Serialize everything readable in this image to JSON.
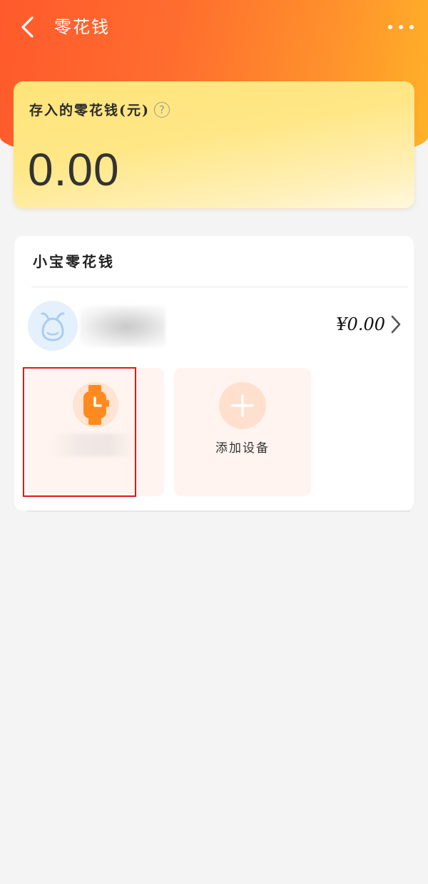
{
  "header": {
    "title": "零花钱",
    "back_icon": "back-arrow-icon",
    "more_icon": "more-dots-icon"
  },
  "balance_card": {
    "label": "存入的零花钱(元)",
    "help_icon": "question-mark-icon",
    "help_glyph": "?",
    "amount": "0.00"
  },
  "kid_section": {
    "title": "小宝零花钱",
    "kid": {
      "avatar_icon": "kid-avatar-icon",
      "balance": "¥0.00"
    },
    "devices": [
      {
        "icon": "watch-icon"
      }
    ],
    "add_device": {
      "icon": "plus-icon",
      "label": "添加设备"
    }
  },
  "colors": {
    "header_gradient_start": "#ff5a2c",
    "header_gradient_end": "#ffb328",
    "card_yellow": "#ffe479",
    "device_orange": "#ff8a1f",
    "tile_bg": "#fff4ef",
    "highlight_red": "#e01818"
  }
}
